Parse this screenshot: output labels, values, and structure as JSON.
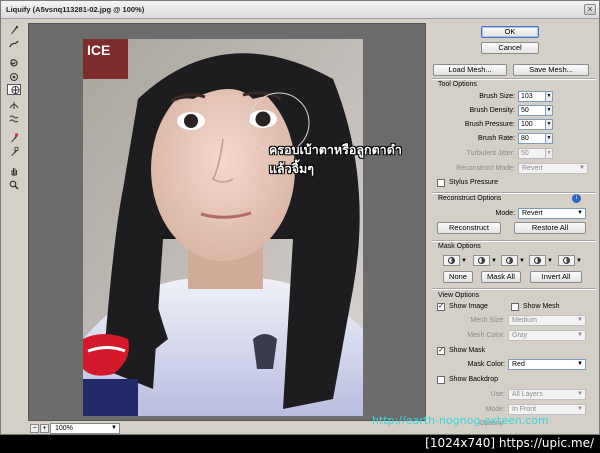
{
  "window": {
    "title": "Liquify (A5vsnq113281-02.jpg @ 100%)",
    "close_symbol": "×"
  },
  "toolbar": {
    "tools": [
      {
        "icon": "forward-warp-icon"
      },
      {
        "icon": "reconstruct-icon"
      },
      {
        "icon": "twirl-clockwise-icon"
      },
      {
        "icon": "pucker-icon"
      },
      {
        "icon": "bloat-icon",
        "selected": true
      },
      {
        "icon": "push-left-icon"
      },
      {
        "icon": "mirror-icon"
      },
      {
        "icon": "turbulence-icon"
      },
      {
        "icon": "freeze-mask-icon"
      },
      {
        "icon": "thaw-mask-icon"
      },
      {
        "icon": "hand-icon"
      },
      {
        "icon": "zoom-icon"
      }
    ]
  },
  "canvas": {
    "photo_sign_text": "ICE",
    "overlay_text": [
      "ครอบเบ้าตาหรือลูกตาดำ",
      "แล้วจิ้มๆ"
    ],
    "watermark": "http://earth-nognog.exteen.com"
  },
  "statusbar": {
    "zoom_minus": "−",
    "zoom_plus": "+",
    "zoom_value": "100%"
  },
  "buttons": {
    "ok": "OK",
    "cancel": "Cancel",
    "load_mesh": "Load Mesh...",
    "save_mesh": "Save Mesh..."
  },
  "tool_options": {
    "title": "Tool Options",
    "brush_size": {
      "label": "Brush Size:",
      "value": "103"
    },
    "brush_density": {
      "label": "Brush Density:",
      "value": "50"
    },
    "brush_pressure": {
      "label": "Brush Pressure:",
      "value": "100"
    },
    "brush_rate": {
      "label": "Brush Rate:",
      "value": "80"
    },
    "turbulent_jitter": {
      "label": "Turbulent Jitter:",
      "value": "50"
    },
    "reconstruct_mode": {
      "label": "Reconstruct Mode:",
      "value": "Revert"
    },
    "stylus_pressure": "Stylus Pressure"
  },
  "reconstruct_options": {
    "title": "Reconstruct Options",
    "mode": {
      "label": "Mode:",
      "value": "Revert"
    },
    "reconstruct_button": "Reconstruct",
    "restore_all_button": "Restore All",
    "info": "i"
  },
  "mask_options": {
    "title": "Mask Options",
    "none": "None",
    "mask_all": "Mask All",
    "invert_all": "Invert All"
  },
  "view_options": {
    "title": "View Options",
    "show_image": "Show Image",
    "show_mesh": "Show Mesh",
    "mesh_size": {
      "label": "Mesh Size:",
      "value": "Medium"
    },
    "mesh_color": {
      "label": "Mesh Color:",
      "value": "Gray"
    },
    "show_mask": "Show Mask",
    "mask_color": {
      "label": "Mask Color:",
      "value": "Red"
    },
    "show_backdrop": "Show Backdrop",
    "use": {
      "label": "Use:",
      "value": "All Layers"
    },
    "mode": {
      "label": "Mode:",
      "value": "In Front"
    },
    "opacity": {
      "label": "Opacity:"
    }
  },
  "credit": "[1024x740] https://upic.me/",
  "colors": {
    "watermark": "#39d7d7",
    "default_button": "#4a76c6"
  }
}
